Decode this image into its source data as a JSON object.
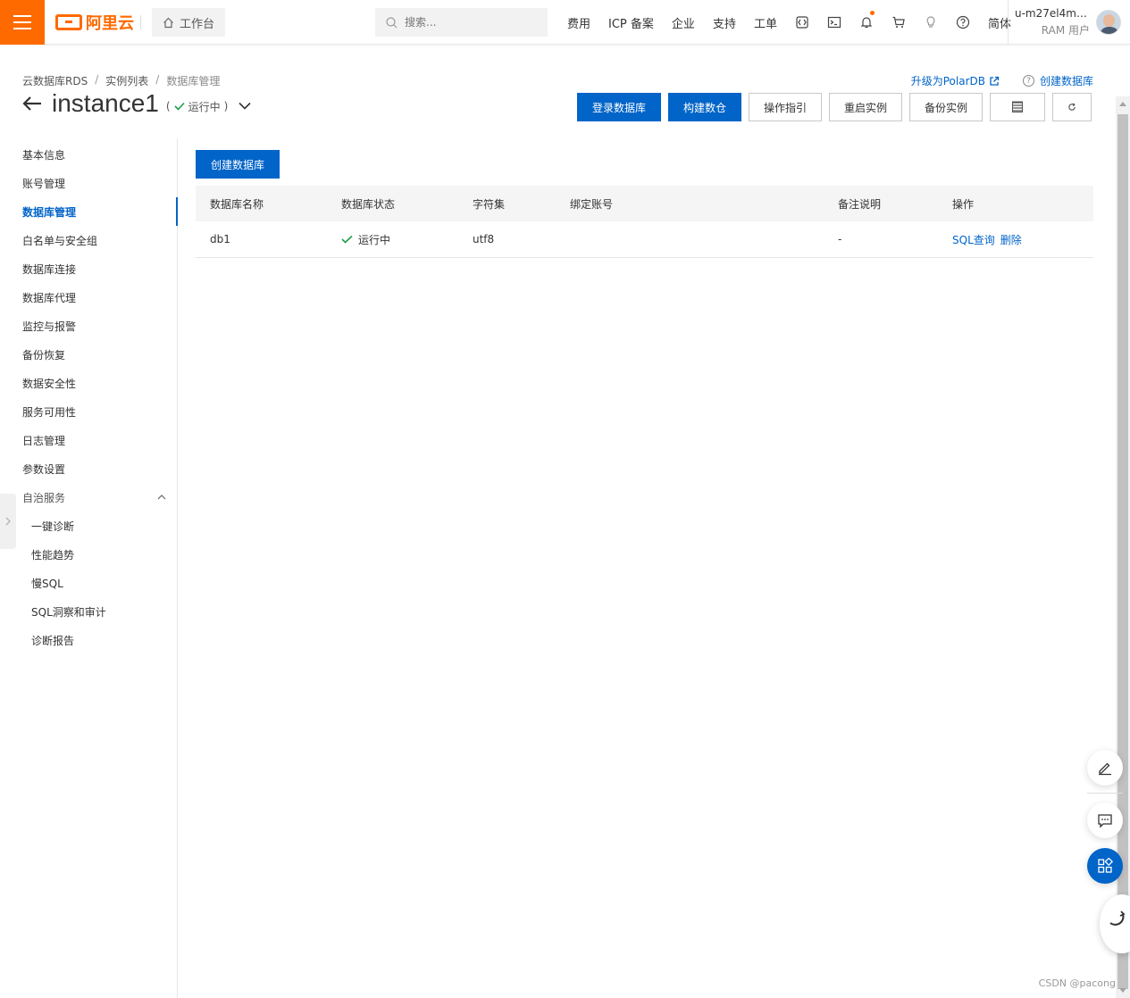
{
  "topbar": {
    "brand": "阿里云",
    "workbench_label": "工作台",
    "search_placeholder": "搜索...",
    "nav_links": [
      "费用",
      "ICP 备案",
      "企业",
      "支持",
      "工单"
    ],
    "lang_label": "简体",
    "user_name": "u-m27el4mo...",
    "user_role": "RAM 用户",
    "accent_color": "#ff6a00"
  },
  "breadcrumb": [
    "云数据库RDS",
    "实例列表",
    "数据库管理"
  ],
  "header": {
    "title": "instance1",
    "status_prefix": "(",
    "status_label": "运行中",
    "status_suffix": ")",
    "link_upgrade": "升级为PolarDB",
    "link_create": "创建数据库"
  },
  "actions": {
    "login_db": "登录数据库",
    "build_warehouse": "构建数仓",
    "guide": "操作指引",
    "restart": "重启实例",
    "backup": "备份实例"
  },
  "sidebar": {
    "items": [
      "基本信息",
      "账号管理",
      "数据库管理",
      "白名单与安全组",
      "数据库连接",
      "数据库代理",
      "监控与报警",
      "备份恢复",
      "数据安全性",
      "服务可用性",
      "日志管理",
      "参数设置"
    ],
    "active_index": 2,
    "group_label": "自治服务",
    "sub_items": [
      "一键诊断",
      "性能趋势",
      "慢SQL",
      "SQL洞察和审计",
      "诊断报告"
    ]
  },
  "main": {
    "create_button": "创建数据库",
    "columns": [
      "数据库名称",
      "数据库状态",
      "字符集",
      "绑定账号",
      "备注说明",
      "操作"
    ],
    "rows": [
      {
        "name": "db1",
        "status": "运行中",
        "charset": "utf8",
        "account": "",
        "remark": "-",
        "op_sql": "SQL查询",
        "op_delete": "删除"
      }
    ]
  },
  "primary_color": "#0064c8",
  "success_color": "#1e9e4a",
  "watermark": "CSDN @pacong"
}
